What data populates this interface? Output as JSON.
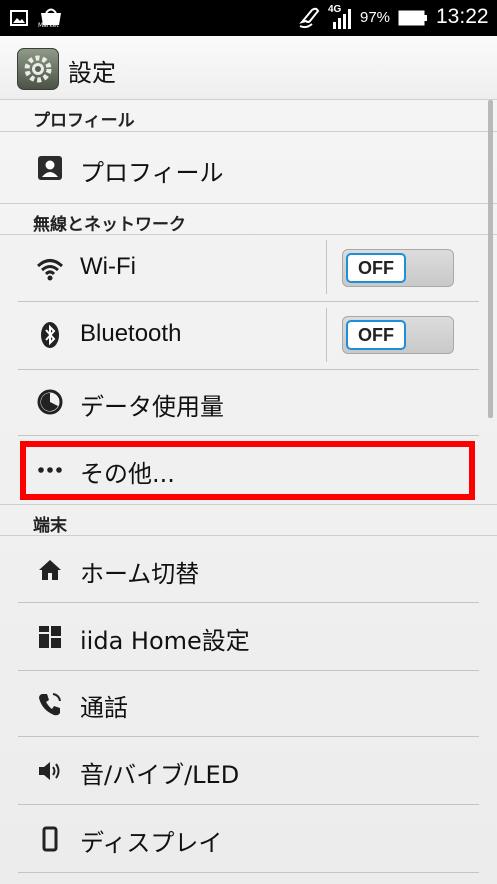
{
  "status_bar": {
    "network": "4G",
    "battery": "97%",
    "time": "13:22",
    "market_label": "Market",
    "icons": [
      "image-icon",
      "market-icon",
      "nfc-icon",
      "signal-icon",
      "battery-icon"
    ]
  },
  "action_bar": {
    "title": "設定",
    "icon": "settings-gear-icon"
  },
  "sections": {
    "profile_header": "プロフィール",
    "wireless_header": "無線とネットワーク",
    "device_header": "端末"
  },
  "items": {
    "profile": {
      "label": "プロフィール",
      "icon": "profile-icon"
    },
    "wifi": {
      "label": "Wi-Fi",
      "icon": "wifi-icon",
      "toggle": "OFF"
    },
    "bluetooth": {
      "label": "Bluetooth",
      "icon": "bluetooth-icon",
      "toggle": "OFF"
    },
    "data_usage": {
      "label": "データ使用量",
      "icon": "data-usage-icon"
    },
    "more": {
      "label": "その他...",
      "icon": "more-dots-icon"
    },
    "home_switch": {
      "label": "ホーム切替",
      "icon": "home-icon"
    },
    "iida_home": {
      "label": "iida Home設定",
      "icon": "grid-icon"
    },
    "call": {
      "label": "通話",
      "icon": "phone-icon"
    },
    "sound": {
      "label": "音/バイブ/LED",
      "icon": "speaker-icon"
    },
    "display": {
      "label": "ディスプレイ",
      "icon": "display-icon"
    }
  },
  "colors": {
    "highlight": "#ff0000",
    "toggle_accent": "#1d8fd8"
  }
}
